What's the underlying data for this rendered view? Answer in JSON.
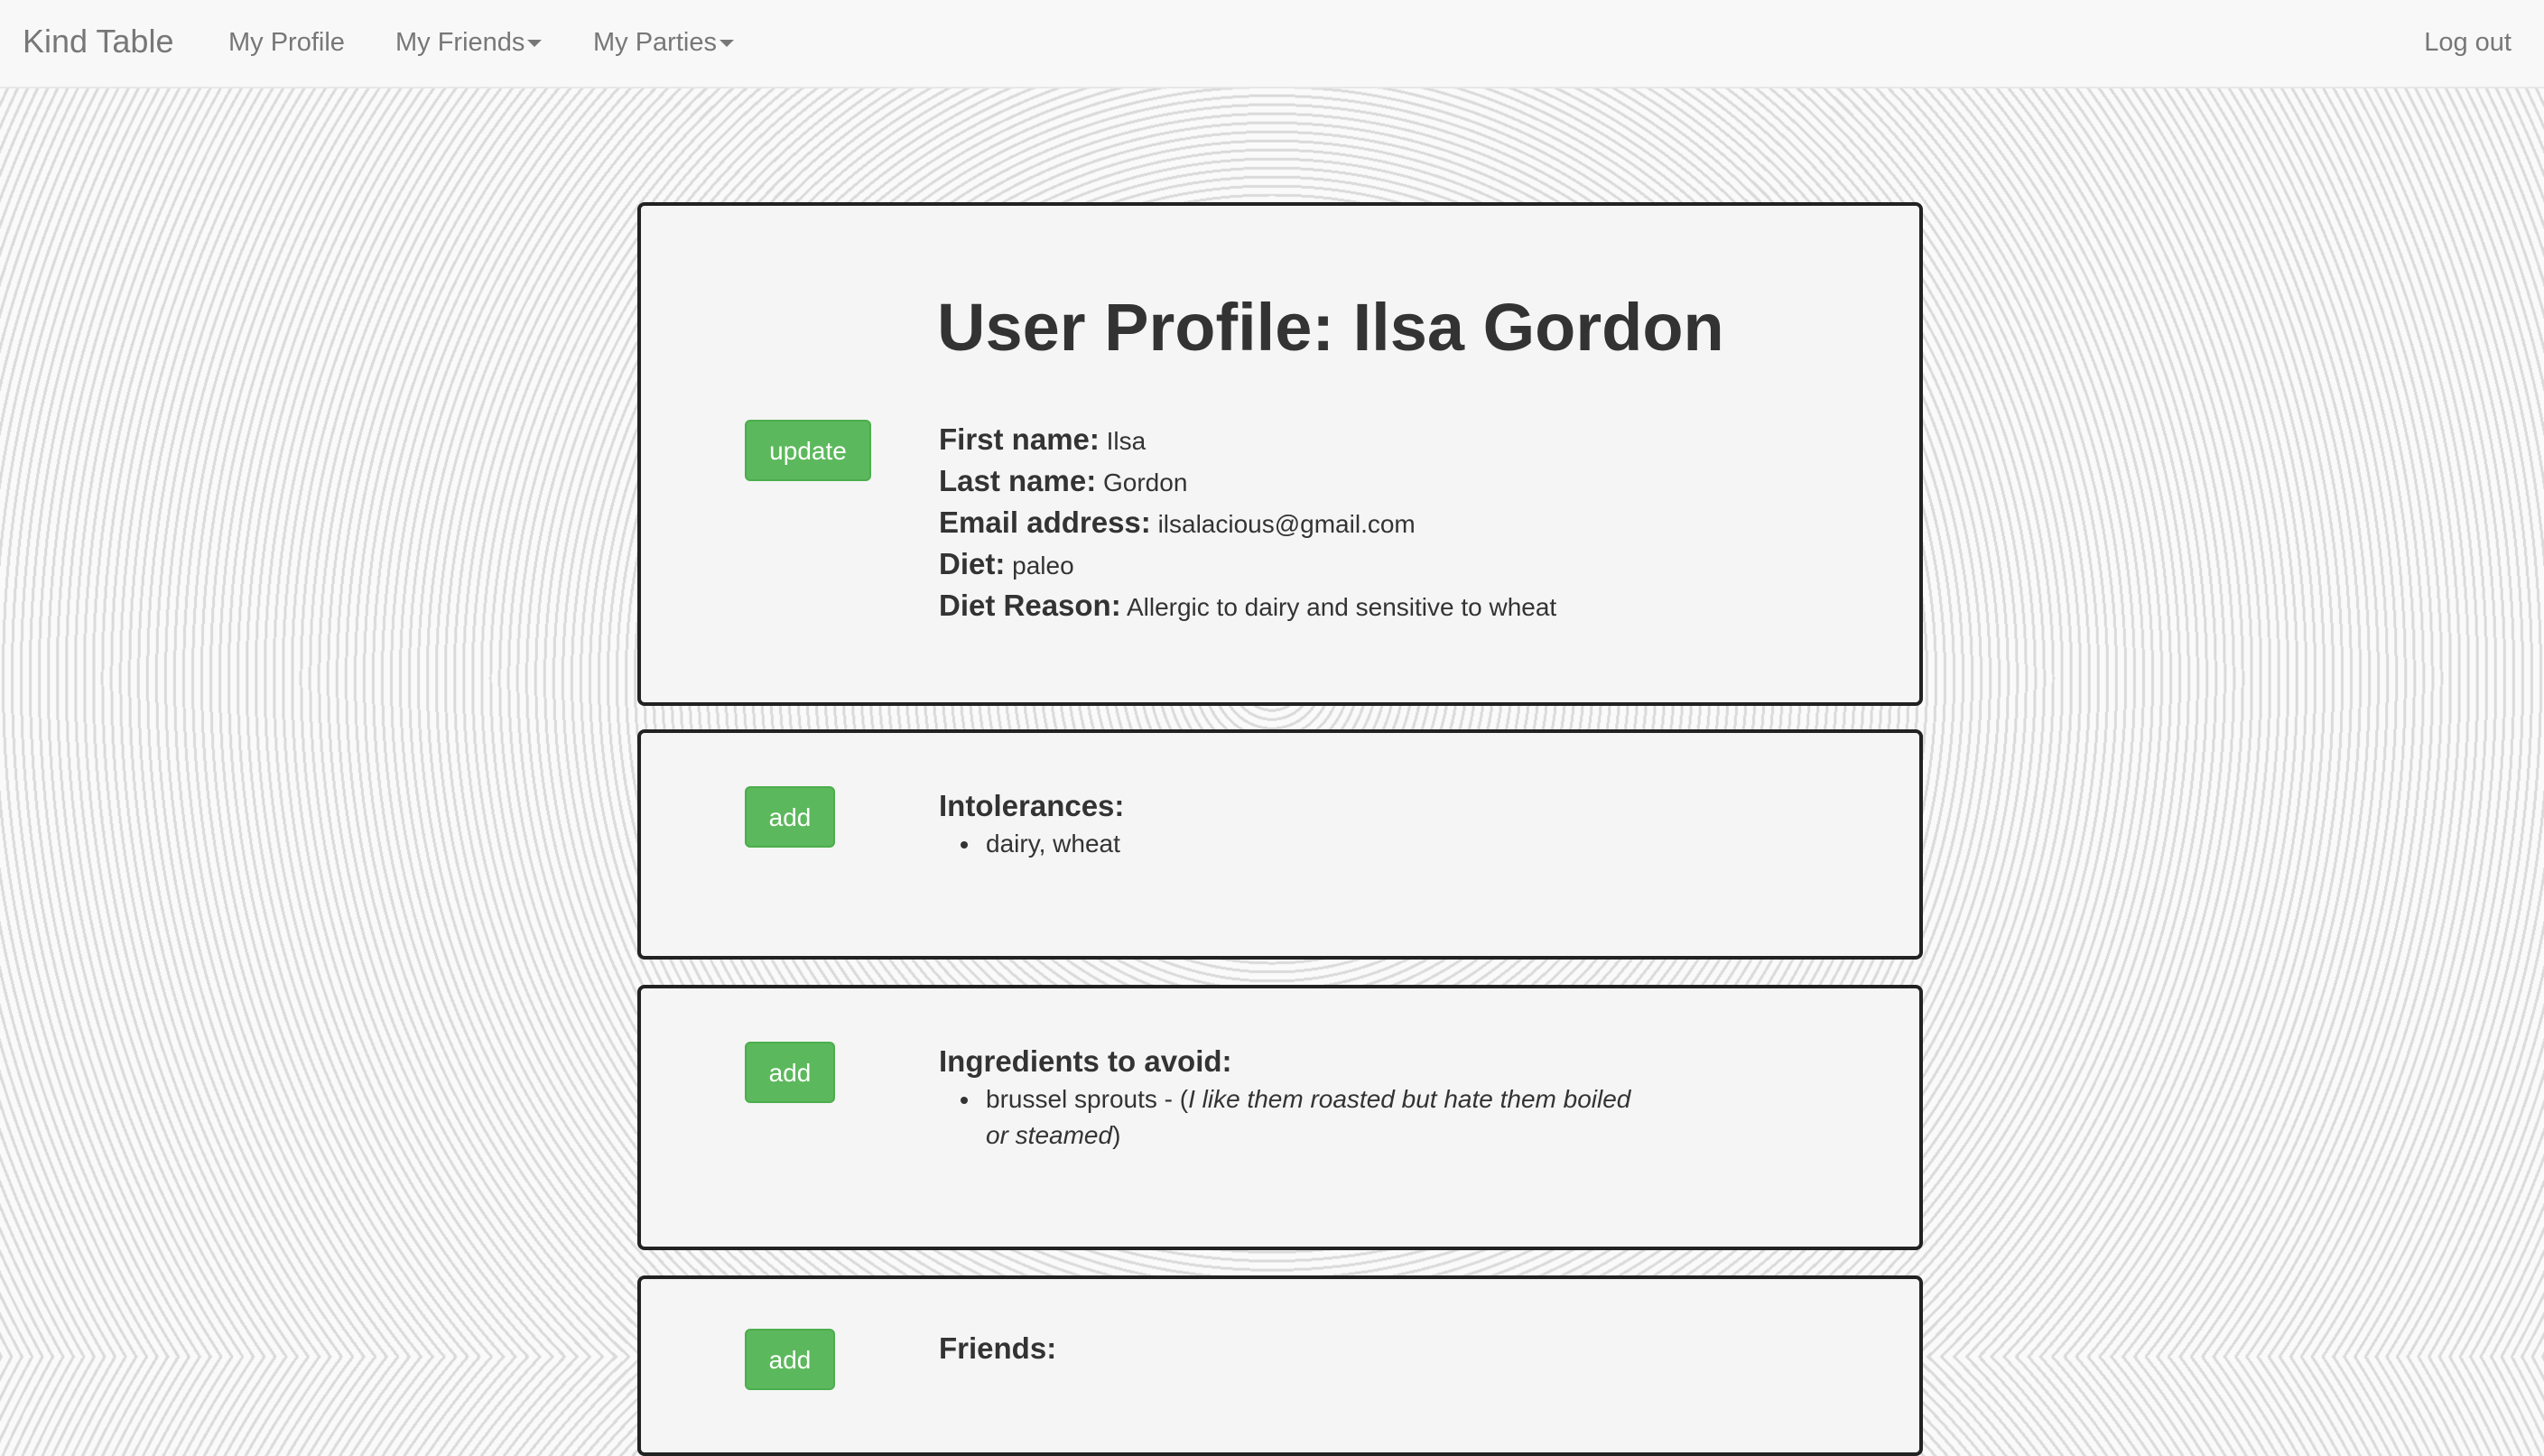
{
  "navbar": {
    "brand": "Kind Table",
    "my_profile": "My Profile",
    "my_friends": "My Friends",
    "my_parties": "My Parties",
    "logout": "Log out"
  },
  "profile": {
    "title": "User Profile: Ilsa Gordon",
    "update_label": "update",
    "fields": [
      {
        "label": "First name:",
        "value": "Ilsa"
      },
      {
        "label": "Last name:",
        "value": "Gordon"
      },
      {
        "label": "Email address:",
        "value": "ilsalacious@gmail.com"
      },
      {
        "label": "Diet:",
        "value": "paleo"
      },
      {
        "label": "Diet Reason:",
        "value": "Allergic to dairy and sensitive to wheat"
      }
    ]
  },
  "intolerances": {
    "heading": "Intolerances:",
    "add_label": "add",
    "items": [
      "dairy, wheat"
    ]
  },
  "ingredients": {
    "heading": "Ingredients to avoid:",
    "add_label": "add",
    "item_name": "brussel sprouts - (",
    "item_note_line1": "I like them roasted but hate them boiled",
    "item_note_line2": "or steamed",
    "item_close": ")"
  },
  "friends": {
    "heading": "Friends:",
    "add_label": "add"
  },
  "colors": {
    "button": "#5cb85c",
    "panel_border": "#222222",
    "panel_bg": "#f5f5f5",
    "navbar_bg": "#f8f8f8"
  }
}
